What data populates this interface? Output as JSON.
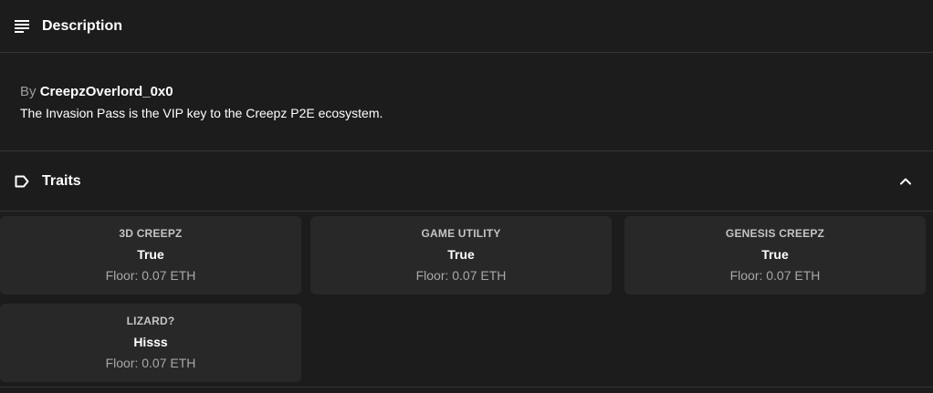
{
  "description_section": {
    "title": "Description",
    "icon": "list-lines-icon",
    "by_prefix": "By",
    "author": "CreepzOverlord_0x0",
    "text": "The Invasion Pass is the VIP key to the Creepz P2E ecosystem."
  },
  "traits_section": {
    "title": "Traits",
    "icon": "tag-icon",
    "toggle_icon": "chevron-up-icon",
    "traits": [
      {
        "type": "3D CREEPZ",
        "value": "True",
        "floor": "Floor: 0.07 ETH"
      },
      {
        "type": "GAME UTILITY",
        "value": "True",
        "floor": "Floor: 0.07 ETH"
      },
      {
        "type": "GENESIS CREEPZ",
        "value": "True",
        "floor": "Floor: 0.07 ETH"
      },
      {
        "type": "LIZARD?",
        "value": "Hisss",
        "floor": "Floor: 0.07 ETH"
      }
    ]
  },
  "colors": {
    "background": "#1c1c1c",
    "card": "#282828",
    "divider": "#343434",
    "muted_text": "#a8a8a8"
  }
}
